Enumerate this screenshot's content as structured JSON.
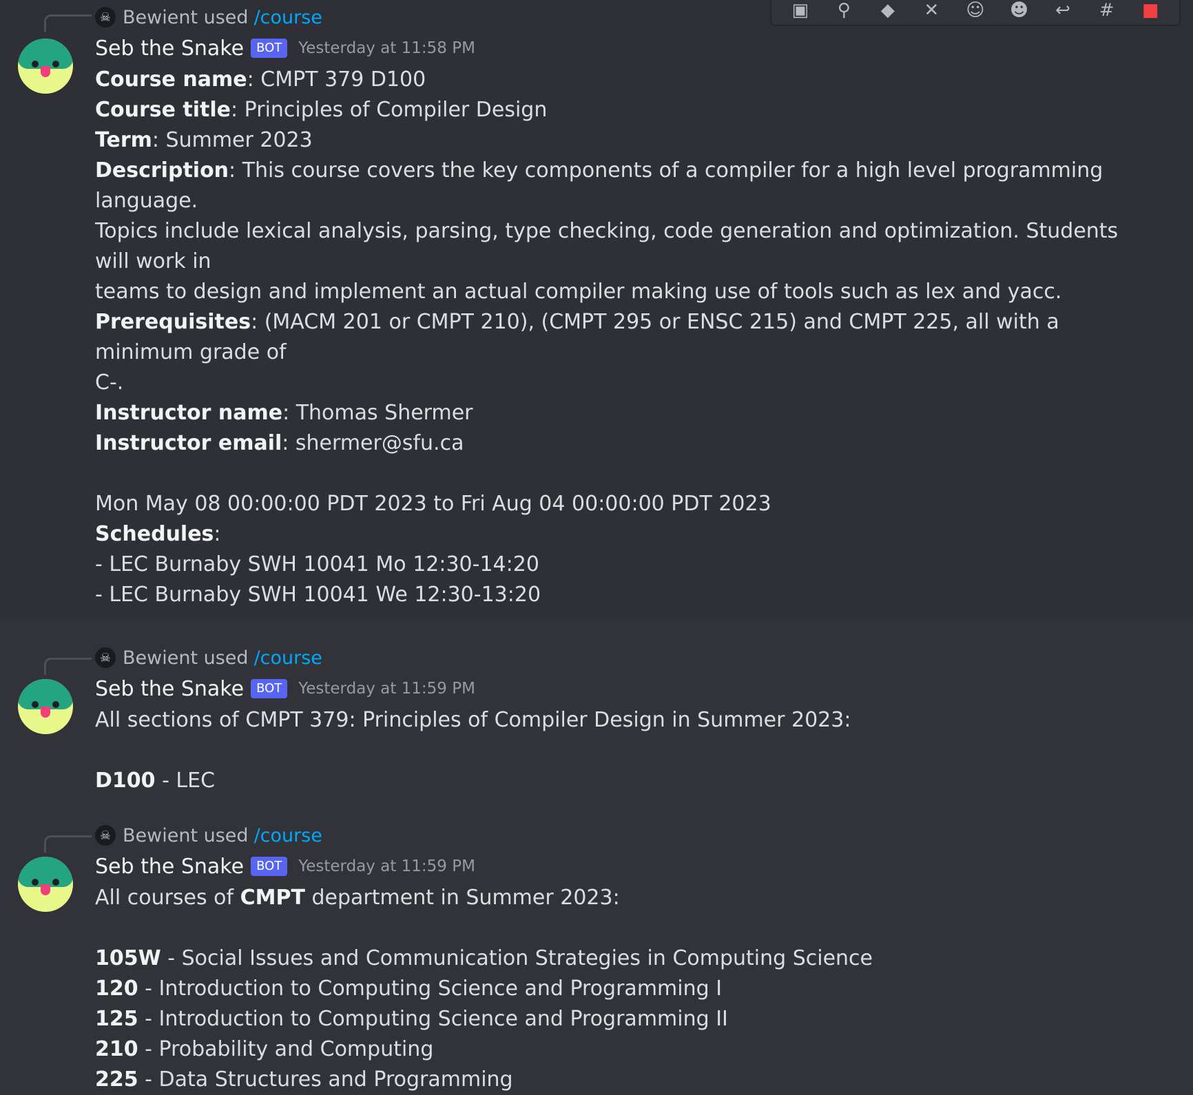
{
  "toolbar": {
    "items": [
      {
        "icon": "id-icon",
        "glyph": "▣"
      },
      {
        "icon": "link-icon",
        "glyph": "⚲"
      },
      {
        "icon": "tag-icon",
        "glyph": "◆"
      },
      {
        "icon": "pin-icon",
        "glyph": "✕"
      },
      {
        "icon": "emoji-icon",
        "glyph": "☺"
      },
      {
        "icon": "add-reaction-icon",
        "glyph": "☻"
      },
      {
        "icon": "reply-icon",
        "glyph": "↩"
      },
      {
        "icon": "thread-icon",
        "glyph": "#"
      },
      {
        "icon": "delete-icon",
        "glyph": "■"
      }
    ]
  },
  "messages": [
    {
      "reply": {
        "user": "Bewient",
        "used": "used",
        "command": "/course"
      },
      "author": "Seb the Snake",
      "badge": "BOT",
      "timestamp": "Yesterday at 11:58 PM",
      "lines": [
        {
          "bold": "Course name",
          "text": ": CMPT 379 D100"
        },
        {
          "bold": "Course title",
          "text": ": Principles of Compiler Design"
        },
        {
          "bold": "Term",
          "text": ": Summer 2023"
        },
        {
          "bold": "Description",
          "text": ": This course covers the key components of a compiler for a high level programming language."
        },
        {
          "bold": "",
          "text": "Topics include lexical analysis, parsing, type checking, code generation and optimization. Students will work in"
        },
        {
          "bold": "",
          "text": "teams to design and implement an actual compiler making use of tools such as lex and yacc."
        },
        {
          "bold": "Prerequisites",
          "text": ": (MACM 201 or CMPT 210), (CMPT 295 or ENSC 215) and CMPT 225, all with a minimum grade of"
        },
        {
          "bold": "",
          "text": "C-."
        },
        {
          "bold": "Instructor name",
          "text": ": Thomas Shermer"
        },
        {
          "bold": "Instructor email",
          "text": ": shermer@sfu.ca"
        },
        {
          "bold": "",
          "text": ""
        },
        {
          "bold": "",
          "text": "Mon May 08 00:00:00 PDT 2023 to Fri Aug 04 00:00:00 PDT 2023"
        },
        {
          "bold": "Schedules",
          "text": ":"
        },
        {
          "bold": "",
          "text": "- LEC Burnaby SWH 10041 Mo 12:30-14:20"
        },
        {
          "bold": "",
          "text": "- LEC Burnaby SWH 10041 We 12:30-13:20"
        }
      ]
    },
    {
      "reply": {
        "user": "Bewient",
        "used": "used",
        "command": "/course"
      },
      "author": "Seb the Snake",
      "badge": "BOT",
      "timestamp": "Yesterday at 11:59 PM",
      "lines": [
        {
          "bold": "",
          "text": "All sections of CMPT 379: Principles of Compiler Design in Summer 2023:"
        },
        {
          "bold": "",
          "text": ""
        },
        {
          "bold": "D100",
          "text": " - LEC"
        }
      ]
    },
    {
      "reply": {
        "user": "Bewient",
        "used": "used",
        "command": "/course"
      },
      "author": "Seb the Snake",
      "badge": "BOT",
      "timestamp": "Yesterday at 11:59 PM",
      "lines": [
        {
          "pre": "All courses of ",
          "bold": "CMPT",
          "text": " department in Summer 2023:"
        },
        {
          "bold": "",
          "text": ""
        },
        {
          "bold": "105W",
          "text": " - Social Issues and Communication Strategies in Computing Science"
        },
        {
          "bold": "120",
          "text": " - Introduction to Computing Science and Programming I"
        },
        {
          "bold": "125",
          "text": " - Introduction to Computing Science and Programming II"
        },
        {
          "bold": "210",
          "text": " - Probability and Computing"
        },
        {
          "bold": "225",
          "text": " - Data Structures and Programming"
        }
      ]
    }
  ]
}
